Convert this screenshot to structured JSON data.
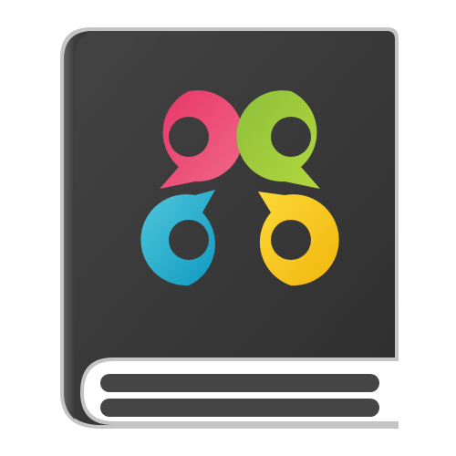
{
  "icon": {
    "name": "book-app-icon",
    "colors": {
      "cover": "#3a3a3a",
      "cover_edge": "#bdbdbd",
      "pages": "#ffffff",
      "page_lines": "#444444",
      "pink": "#e5406a",
      "green": "#98c53a",
      "blue": "#1fa5c6",
      "yellow": "#f5c012"
    },
    "bubbles": [
      {
        "name": "pink-speech-bubble-icon",
        "color": "pink"
      },
      {
        "name": "green-speech-bubble-icon",
        "color": "green"
      },
      {
        "name": "blue-speech-bubble-icon",
        "color": "blue"
      },
      {
        "name": "yellow-speech-bubble-icon",
        "color": "yellow"
      }
    ]
  }
}
